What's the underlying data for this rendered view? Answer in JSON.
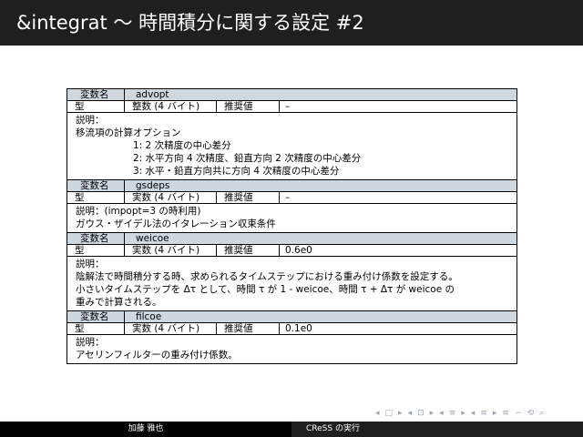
{
  "title": "&integrat 〜 時間積分に関する設定 #2",
  "labels": {
    "var_name": "変数名",
    "type": "型",
    "recommended": "推奨値",
    "description": "説明："
  },
  "params": [
    {
      "name": "advopt",
      "type": "整数 (4 バイト)",
      "recommended": "–",
      "description_header": "説明：",
      "lines": [
        "移流項の計算オプション",
        "1:  2 次精度の中心差分",
        "2:  水平方向 4 次精度、鉛直方向 2 次精度の中心差分",
        "3:  水平・鉛直方向共に方向 4 次精度の中心差分"
      ]
    },
    {
      "name": "gsdeps",
      "type": "実数 (4 バイト)",
      "recommended": "–",
      "description_header": "説明：(impopt=3 の時利用)",
      "lines": [
        "ガウス・ザイデル法のイタレーション収束条件"
      ]
    },
    {
      "name": "weicoe",
      "type": "実数 (4 バイト)",
      "recommended": "0.6e0",
      "description_header": "説明：",
      "lines": [
        "陰解法で時間積分する時、求められるタイムステップにおける重み付け係数を設定する。",
        "小さいタイムステップを Δτ として、時間 τ が 1 - weicoe、時間 τ + Δτ が weicoe の",
        "重みで計算される。"
      ]
    },
    {
      "name": "filcoe",
      "type": "実数 (4 バイト)",
      "recommended": "0.1e0",
      "description_header": "説明：",
      "lines": [
        "アセリンフィルターの重み付け係数。"
      ]
    }
  ],
  "nav_icons": [
    "◂",
    "□",
    "▸",
    "◂",
    "⊡",
    "▸",
    "◂",
    "≡",
    "▸",
    "◂",
    "≡",
    "▸",
    "≡",
    "∽",
    "⟲",
    "⌕"
  ],
  "footer": {
    "author": "加藤 雅也",
    "subtitle": "CReSS の実行"
  }
}
